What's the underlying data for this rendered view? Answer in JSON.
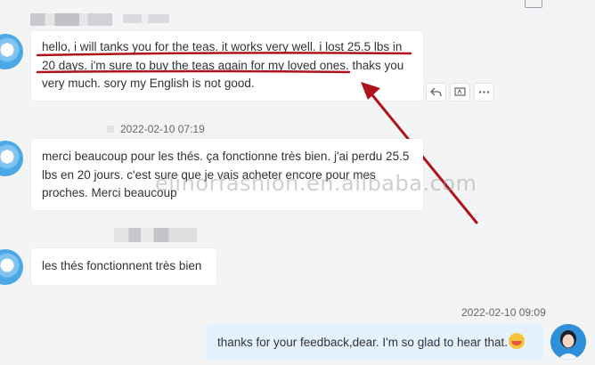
{
  "messages": [
    {
      "text": "hello, i will tanks you for the teas. it works very well. i lost 25.5 lbs in 20 days. i'm sure to buy the teas again for my loved ones. thaks you very much. sory my English is not good."
    },
    {
      "timestamp": "2022-02-10 07:19",
      "text": "merci beaucoup pour les thés. ça fonctionne très bien. j'ai perdu 25.5 lbs en 20 jours. c'est sure que je vais acheter encore pour mes proches. Merci beaucoup"
    },
    {
      "text": "les thés fonctionnent très bien"
    },
    {
      "timestamp": "2022-02-10 09:09",
      "text": "thanks for your feedback,dear. I'm so glad to hear that."
    }
  ],
  "watermark": "elinorfashion.en.alibaba.com",
  "message_actions": [
    "reply-icon",
    "translate-icon",
    "more-icon"
  ],
  "emoji": "hot-face-emoji",
  "colors": {
    "background": "#f3f4f6",
    "incoming_bubble": "#ffffff",
    "outgoing_bubble": "#e4f1fe",
    "annotation": "#b0121b",
    "avatar": "#4aa8e6"
  }
}
